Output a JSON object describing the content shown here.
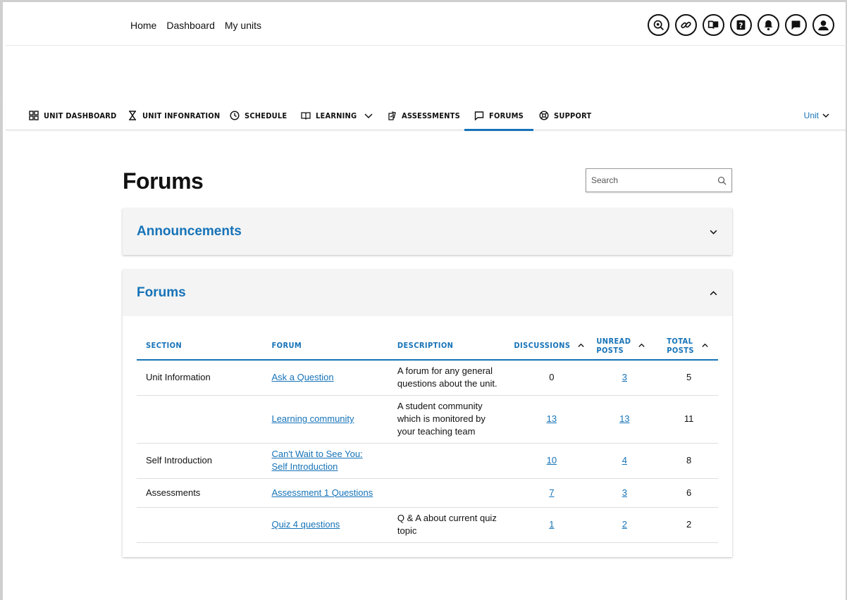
{
  "topnav": {
    "links": [
      "Home",
      "Dashboard",
      "My units"
    ],
    "icons": [
      "accessibility-icon",
      "link-icon",
      "library-icon",
      "help-icon",
      "bell-icon",
      "chat-icon",
      "profile-icon"
    ]
  },
  "unitnav": {
    "items": [
      {
        "label": "UNIT DASHBOARD",
        "icon": "grid-icon"
      },
      {
        "label": "UNIT INFONRATION",
        "icon": "hourglass-icon"
      },
      {
        "label": "SCHEDULE",
        "icon": "clock-icon"
      },
      {
        "label": "LEARNING",
        "icon": "book-icon"
      },
      {
        "label": "ASSESSMENTS",
        "icon": "assessment-icon"
      },
      {
        "label": "FORUMS",
        "icon": "forum-icon",
        "active": true
      },
      {
        "label": "SUPPORT",
        "icon": "lifebuoy-icon"
      }
    ],
    "unit_selector": "Unit"
  },
  "page": {
    "title": "Forums",
    "search_placeholder": "Search"
  },
  "announcements": {
    "title": "Announcements",
    "state": "collapsed"
  },
  "forums_panel": {
    "title": "Forums",
    "state": "expanded",
    "columns": {
      "section": "SECTION",
      "forum": "FORUM",
      "description": "DESCRIPTION",
      "discussions": "DISCUSSIONS",
      "unread_1": "UNREAD",
      "unread_2": "POSTS",
      "total_1": "TOTAL",
      "total_2": "POSTS"
    },
    "rows": [
      {
        "section": "Unit Information",
        "forum": "Ask a Question",
        "description": "A forum for any general questions about the unit.",
        "discussions": "0",
        "discussions_link": false,
        "unread": "3",
        "total": "5"
      },
      {
        "section": "",
        "forum": "Learning community",
        "description": "A student community which is monitored by your teaching team",
        "discussions": "13",
        "discussions_link": true,
        "unread": "13",
        "total": "11"
      },
      {
        "section": "Self Introduction",
        "forum": "Can't Wait to See You: Self Introduction",
        "description": "",
        "discussions": "10",
        "discussions_link": true,
        "unread": "4",
        "total": "8"
      },
      {
        "section": "Assessments",
        "forum": "Assessment 1 Questions",
        "description": "",
        "discussions": "7",
        "discussions_link": true,
        "unread": "3",
        "total": "6"
      },
      {
        "section": "",
        "forum": "Quiz 4 questions",
        "description": "Q & A about current quiz topic",
        "discussions": "1",
        "discussions_link": true,
        "unread": "2",
        "total": "2"
      }
    ]
  },
  "colors": {
    "accent": "#1673b8",
    "panel_header_bg": "#f4f4f4"
  }
}
